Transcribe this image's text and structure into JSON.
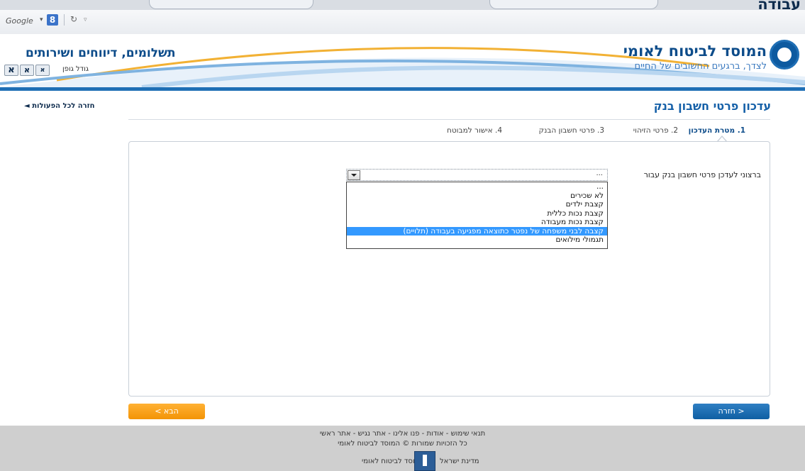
{
  "browser": {
    "corner_text": "עבודה",
    "toolbar": {
      "google_label": "Google"
    }
  },
  "header": {
    "site_title": "המוסד לביטוח לאומי",
    "site_slogan": "לצדך, ברגעים החשובים של החיים",
    "section_title": "תשלומים, דיווחים ושירותים",
    "font_size_label": "גודל גופן",
    "font_buttons": [
      "א",
      "א",
      "א"
    ]
  },
  "page": {
    "title": "עדכון פרטי חשבון בנק",
    "back_all_label": "חזרה לכל הפעולות"
  },
  "steps": [
    {
      "label": "1. מטרת העדכון",
      "active": true
    },
    {
      "label": "2. פרטי הזיהוי",
      "active": false
    },
    {
      "label": "3. פרטי חשבון הבנק",
      "active": false
    },
    {
      "label": "4. אישור למבוטח",
      "active": false
    }
  ],
  "form": {
    "question_label": "ברצוני לעדכן פרטי חשבון בנק עבור",
    "select_value": "...",
    "options": [
      "...",
      "לא שכירים",
      "קצבת ילדים",
      "קצבת נכות כללית",
      "קצבת נכות מעבודה",
      "קצבה לבני משפחה של נפטר כתוצאה מפגיעה בעבודה (תלויים)",
      "תגמולי מילואים"
    ],
    "selected_index": 5
  },
  "buttons": {
    "next_label": "הבא >",
    "back_label": "< חזרה"
  },
  "footer": {
    "links_line": "תנאי שימוש - אודות - פנו אלינו - אתר נגיש - אתר ראשי",
    "copyright": "כל הזכויות שמורות © המוסד לביטוח לאומי",
    "org_name": "המוסד לביטוח לאומי",
    "state_name": "מדינת ישראל"
  },
  "colors": {
    "brand_blue": "#0d4c8a",
    "next_orange": "#f39406",
    "back_blue": "#1f6fb5",
    "selection": "#3399ff"
  }
}
